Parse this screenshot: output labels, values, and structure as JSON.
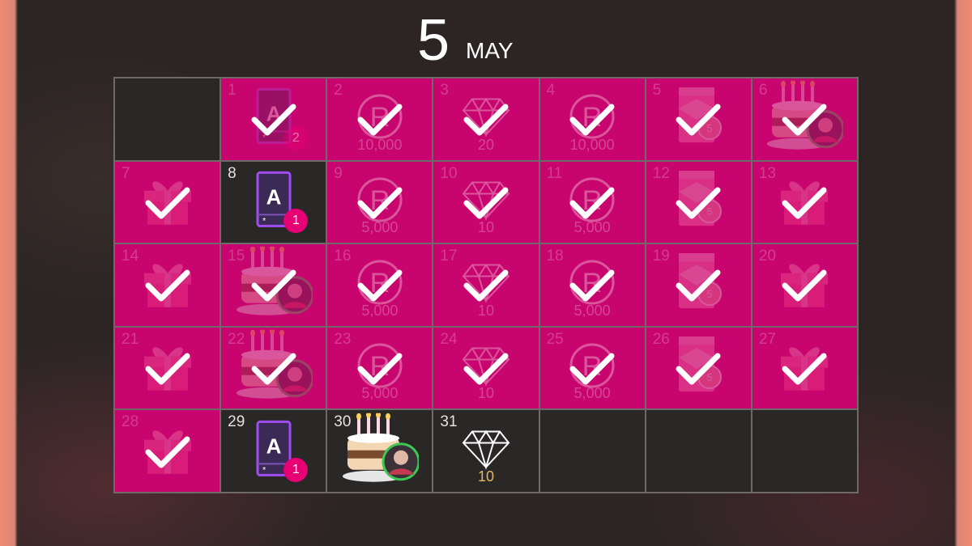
{
  "header": {
    "month_number": "5",
    "month_name": "MAY"
  },
  "colors": {
    "claimed_bg": "#c8056e",
    "empty_bg": "#2a2727",
    "badge": "#e60073",
    "gem_gold": "#e3b766"
  },
  "days": [
    {
      "day": "1",
      "reward": "card-icon",
      "badge": "2",
      "claimed": true
    },
    {
      "day": "2",
      "reward": "coin-icon",
      "amount": "10,000",
      "claimed": true
    },
    {
      "day": "3",
      "reward": "diamond-icon",
      "amount": "20",
      "claimed": true
    },
    {
      "day": "4",
      "reward": "coin-icon",
      "amount": "10,000",
      "claimed": true
    },
    {
      "day": "5",
      "reward": "ticket-bag-icon",
      "claimed": true
    },
    {
      "day": "6",
      "reward": "cake-icon",
      "claimed": true
    },
    {
      "day": "7",
      "reward": "gift-icon",
      "claimed": true
    },
    {
      "day": "8",
      "reward": "card-icon",
      "badge": "1",
      "claimed": false
    },
    {
      "day": "9",
      "reward": "coin-icon",
      "amount": "5,000",
      "claimed": true
    },
    {
      "day": "10",
      "reward": "diamond-icon",
      "amount": "10",
      "claimed": true
    },
    {
      "day": "11",
      "reward": "coin-icon",
      "amount": "5,000",
      "claimed": true
    },
    {
      "day": "12",
      "reward": "ticket-bag-icon",
      "claimed": true
    },
    {
      "day": "13",
      "reward": "gift-icon",
      "claimed": true
    },
    {
      "day": "14",
      "reward": "gift-icon",
      "claimed": true
    },
    {
      "day": "15",
      "reward": "cake-icon",
      "claimed": true
    },
    {
      "day": "16",
      "reward": "coin-icon",
      "amount": "5,000",
      "claimed": true
    },
    {
      "day": "17",
      "reward": "diamond-icon",
      "amount": "10",
      "claimed": true
    },
    {
      "day": "18",
      "reward": "coin-icon",
      "amount": "5,000",
      "claimed": true
    },
    {
      "day": "19",
      "reward": "ticket-bag-icon",
      "claimed": true
    },
    {
      "day": "20",
      "reward": "gift-icon",
      "claimed": true
    },
    {
      "day": "21",
      "reward": "gift-icon",
      "claimed": true
    },
    {
      "day": "22",
      "reward": "cake-icon",
      "claimed": true
    },
    {
      "day": "23",
      "reward": "coin-icon",
      "amount": "5,000",
      "claimed": true
    },
    {
      "day": "24",
      "reward": "diamond-icon",
      "amount": "10",
      "claimed": true
    },
    {
      "day": "25",
      "reward": "coin-icon",
      "amount": "5,000",
      "claimed": true
    },
    {
      "day": "26",
      "reward": "ticket-bag-icon",
      "claimed": true
    },
    {
      "day": "27",
      "reward": "gift-icon",
      "claimed": true
    },
    {
      "day": "28",
      "reward": "gift-icon",
      "claimed": true
    },
    {
      "day": "29",
      "reward": "card-icon",
      "badge": "1",
      "claimed": false
    },
    {
      "day": "30",
      "reward": "cake-icon",
      "claimed": false
    },
    {
      "day": "31",
      "reward": "diamond-icon",
      "amount": "10",
      "claimed": false
    }
  ]
}
